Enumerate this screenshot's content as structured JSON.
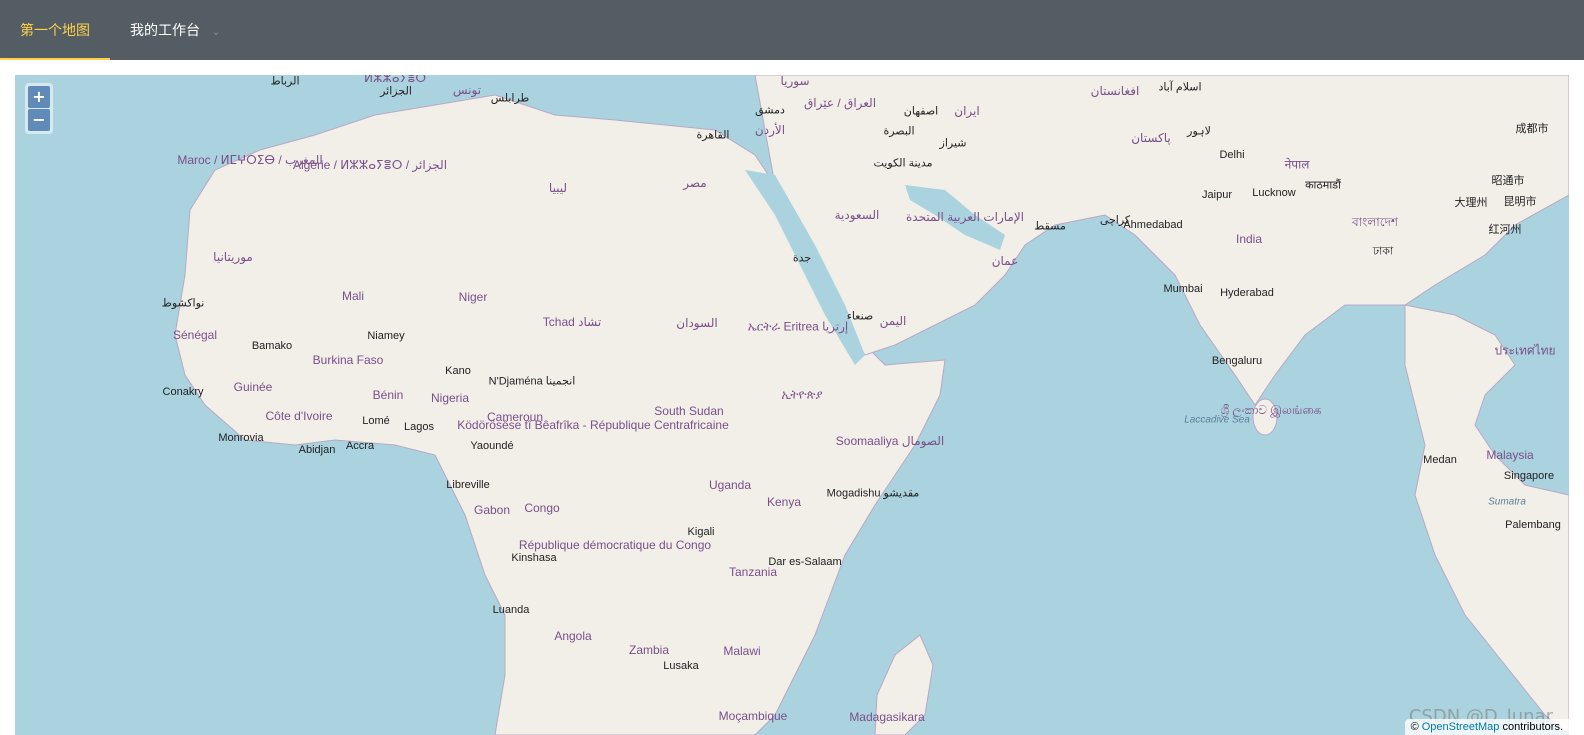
{
  "nav": {
    "items": [
      {
        "label": "第一个地图",
        "active": true
      },
      {
        "label": "我的工作台",
        "has_dropdown": true
      }
    ],
    "active_color": "#ffd04b",
    "background": "#545c64"
  },
  "map": {
    "provider": "OpenStreetMap",
    "zoom_in_label": "+",
    "zoom_out_label": "−",
    "water_color": "#aad3df",
    "land_color": "#f2efe9",
    "country_labels": [
      "Maroc / ⵍⵎⵖⵔⵉⴱ / المغرب",
      "Algérie / ⵍⵣⵣⴰⵢⴻⵔ / الجزائر",
      "ليبيا",
      "مصر",
      "موريتانيا",
      "Mali",
      "Niger",
      "Tchad تشاد",
      "السودان",
      "Sénégal",
      "Guinée",
      "Burkina Faso",
      "Bénin",
      "Nigeria",
      "Côte d'Ivoire",
      "Cameroun",
      "Ködörösêse tî Bêafrîka - République Centrafricaine",
      "South Sudan",
      "ኢትዮጵያ",
      "Soomaaliya الصومال",
      "Uganda",
      "Kenya",
      "Gabon",
      "Congo",
      "République démocratique du Congo",
      "Tanzania",
      "Angola",
      "Zambia",
      "Malawi",
      "Moçambique",
      "Madagasikara",
      "السعودية",
      "اليمن",
      "عمان",
      "الإمارات العربية المتحدة",
      "العراق / عێراق",
      "ایران",
      "پاکستان",
      "افغانستان",
      "India",
      "ශ්‍රී ලංකාව இலங்கை",
      "नेपाल",
      "বাংলাদেশ",
      "Malaysia",
      "ประเทศไทย",
      "ኤርትራ Eritrea إرتريا",
      "سوريا",
      "الأردن",
      "تونس",
      "ⵍⵣⵣⴰⵢⴻⵔ"
    ],
    "city_labels": [
      "الرباط",
      "الجزائر",
      "طرابلس",
      "القاهرة",
      "دمشق",
      "البصرة",
      "اصفهان",
      "شيراز",
      "مدينة الكويت",
      "مسقط",
      "كراچى",
      "اسلام آباد",
      "لاہور",
      "Delhi",
      "Jaipur",
      "Lucknow",
      "Ahmedabad",
      "Mumbai",
      "Hyderabad",
      "Bengaluru",
      "成都市",
      "昭通市",
      "大理州",
      "昆明市",
      "红河州",
      "جدة",
      "صنعاء",
      "نواكشوط",
      "Bamako",
      "Niamey",
      "Kano",
      "N'Djaména انجمينا",
      "Conakry",
      "Monrovia",
      "Abidjan",
      "Accra",
      "Lomé",
      "Lagos",
      "Yaoundé",
      "Libreville",
      "Kigali",
      "Mogadishu مقديشو",
      "Dar es-Salaam",
      "Kinshasa",
      "Luanda",
      "Lusaka",
      "Medan",
      "Singapore",
      "Palembang",
      "काठमाडौं",
      "ঢাকা"
    ],
    "sea_labels": [
      "Laccadive Sea",
      "Sumatra"
    ],
    "attribution_prefix": "©",
    "attribution_link": "OpenStreetMap",
    "attribution_suffix": "contributors."
  },
  "watermark": "CSDN @D_lunar"
}
